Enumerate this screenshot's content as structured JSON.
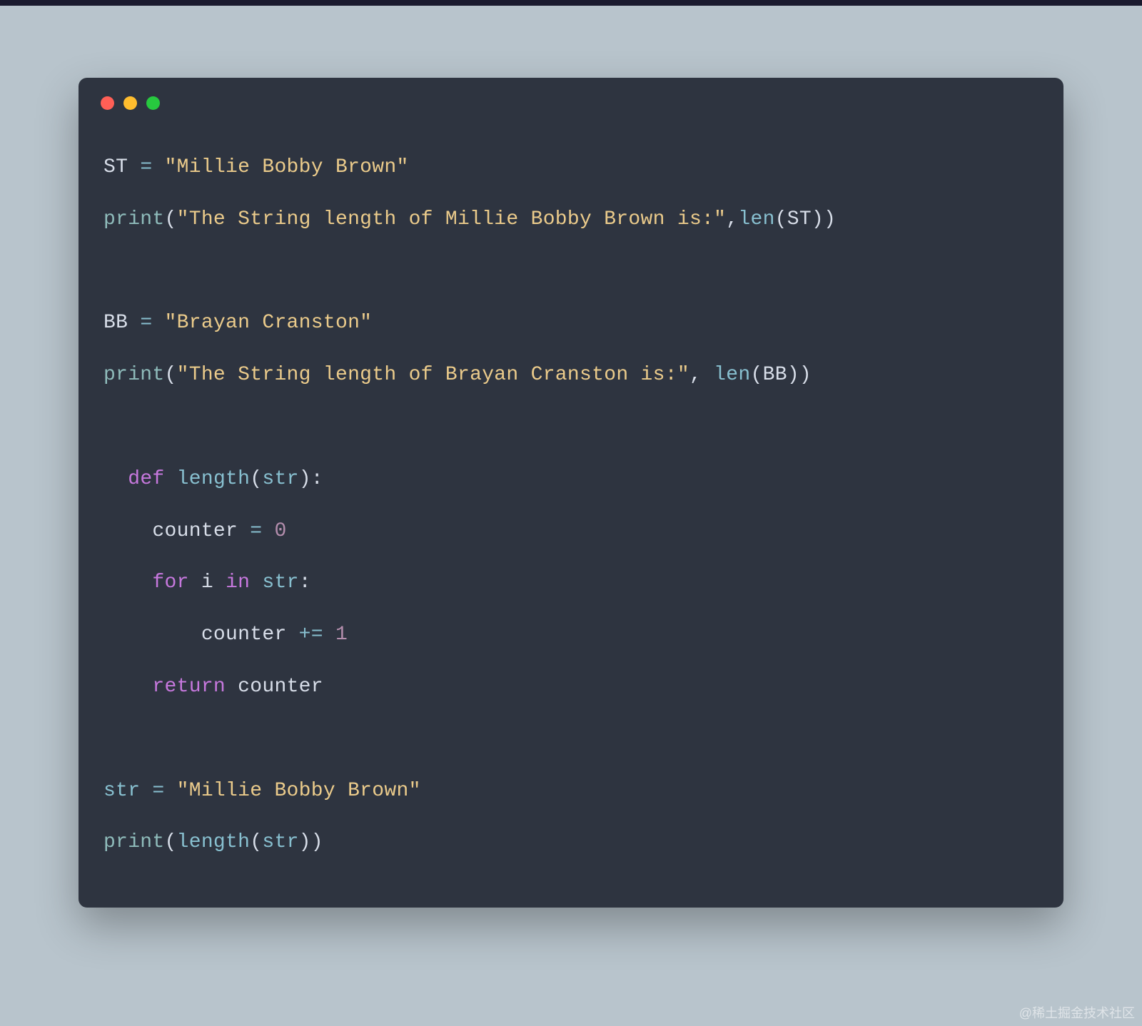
{
  "code": {
    "line1": {
      "var": "ST",
      "op": " = ",
      "str": "\"Millie Bobby Brown\""
    },
    "line2": {
      "func": "print",
      "paren1": "(",
      "str": "\"The String length of Millie Bobby Brown is:\"",
      "comma": ",",
      "builtin": "len",
      "paren2": "(",
      "var": "ST",
      "paren3": "))"
    },
    "line3": {
      "var": "BB",
      "op": " = ",
      "str": "\"Brayan Cranston\""
    },
    "line4": {
      "func": "print",
      "paren1": "(",
      "str": "\"The String length of Brayan Cranston is:\"",
      "comma": ", ",
      "builtin": "len",
      "paren2": "(",
      "var": "BB",
      "paren3": "))"
    },
    "line5": {
      "indent": "  ",
      "kw": "def",
      "space": " ",
      "fname": "length",
      "paren1": "(",
      "param": "str",
      "paren2": "):"
    },
    "line6": {
      "indent": "    ",
      "var": "counter",
      "op": " = ",
      "num": "0"
    },
    "line7": {
      "indent": "    ",
      "kw1": "for",
      "sp1": " ",
      "var1": "i",
      "sp2": " ",
      "kw2": "in",
      "sp3": " ",
      "var2": "str",
      "colon": ":"
    },
    "line8": {
      "indent": "        ",
      "var": "counter",
      "op": " += ",
      "num": "1"
    },
    "line9": {
      "indent": "    ",
      "kw": "return",
      "sp": " ",
      "var": "counter"
    },
    "line10": {
      "var": "str",
      "op": " = ",
      "str": "\"Millie Bobby Brown\""
    },
    "line11": {
      "func": "print",
      "paren1": "(",
      "fname": "length",
      "paren2": "(",
      "var": "str",
      "paren3": "))"
    }
  },
  "watermark": "@稀土掘金技术社区"
}
